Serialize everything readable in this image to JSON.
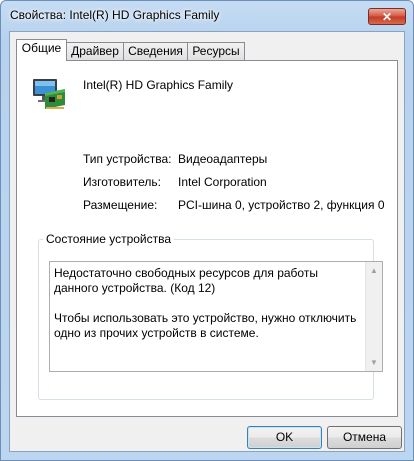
{
  "window": {
    "title": "Свойства: Intel(R) HD Graphics Family",
    "close_label": "✕"
  },
  "tabs": [
    {
      "label": "Общие",
      "active": true
    },
    {
      "label": "Драйвер",
      "active": false
    },
    {
      "label": "Сведения",
      "active": false
    },
    {
      "label": "Ресурсы",
      "active": false
    }
  ],
  "device": {
    "name": "Intel(R) HD Graphics Family",
    "icon": "display-adapter-icon"
  },
  "properties": [
    {
      "label": "Тип устройства:",
      "value": "Видеоадаптеры"
    },
    {
      "label": "Изготовитель:",
      "value": "Intel Corporation"
    },
    {
      "label": "Размещение:",
      "value": "PCI-шина 0, устройство 2, функция 0"
    }
  ],
  "status": {
    "group_label": "Состояние устройства",
    "line1": "Недостаточно свободных ресурсов для работы данного устройства. (Код 12)",
    "line2": "Чтобы использовать это устройство, нужно отключить одно из прочих устройств в системе."
  },
  "buttons": {
    "ok": "OK",
    "cancel": "Отмена"
  }
}
